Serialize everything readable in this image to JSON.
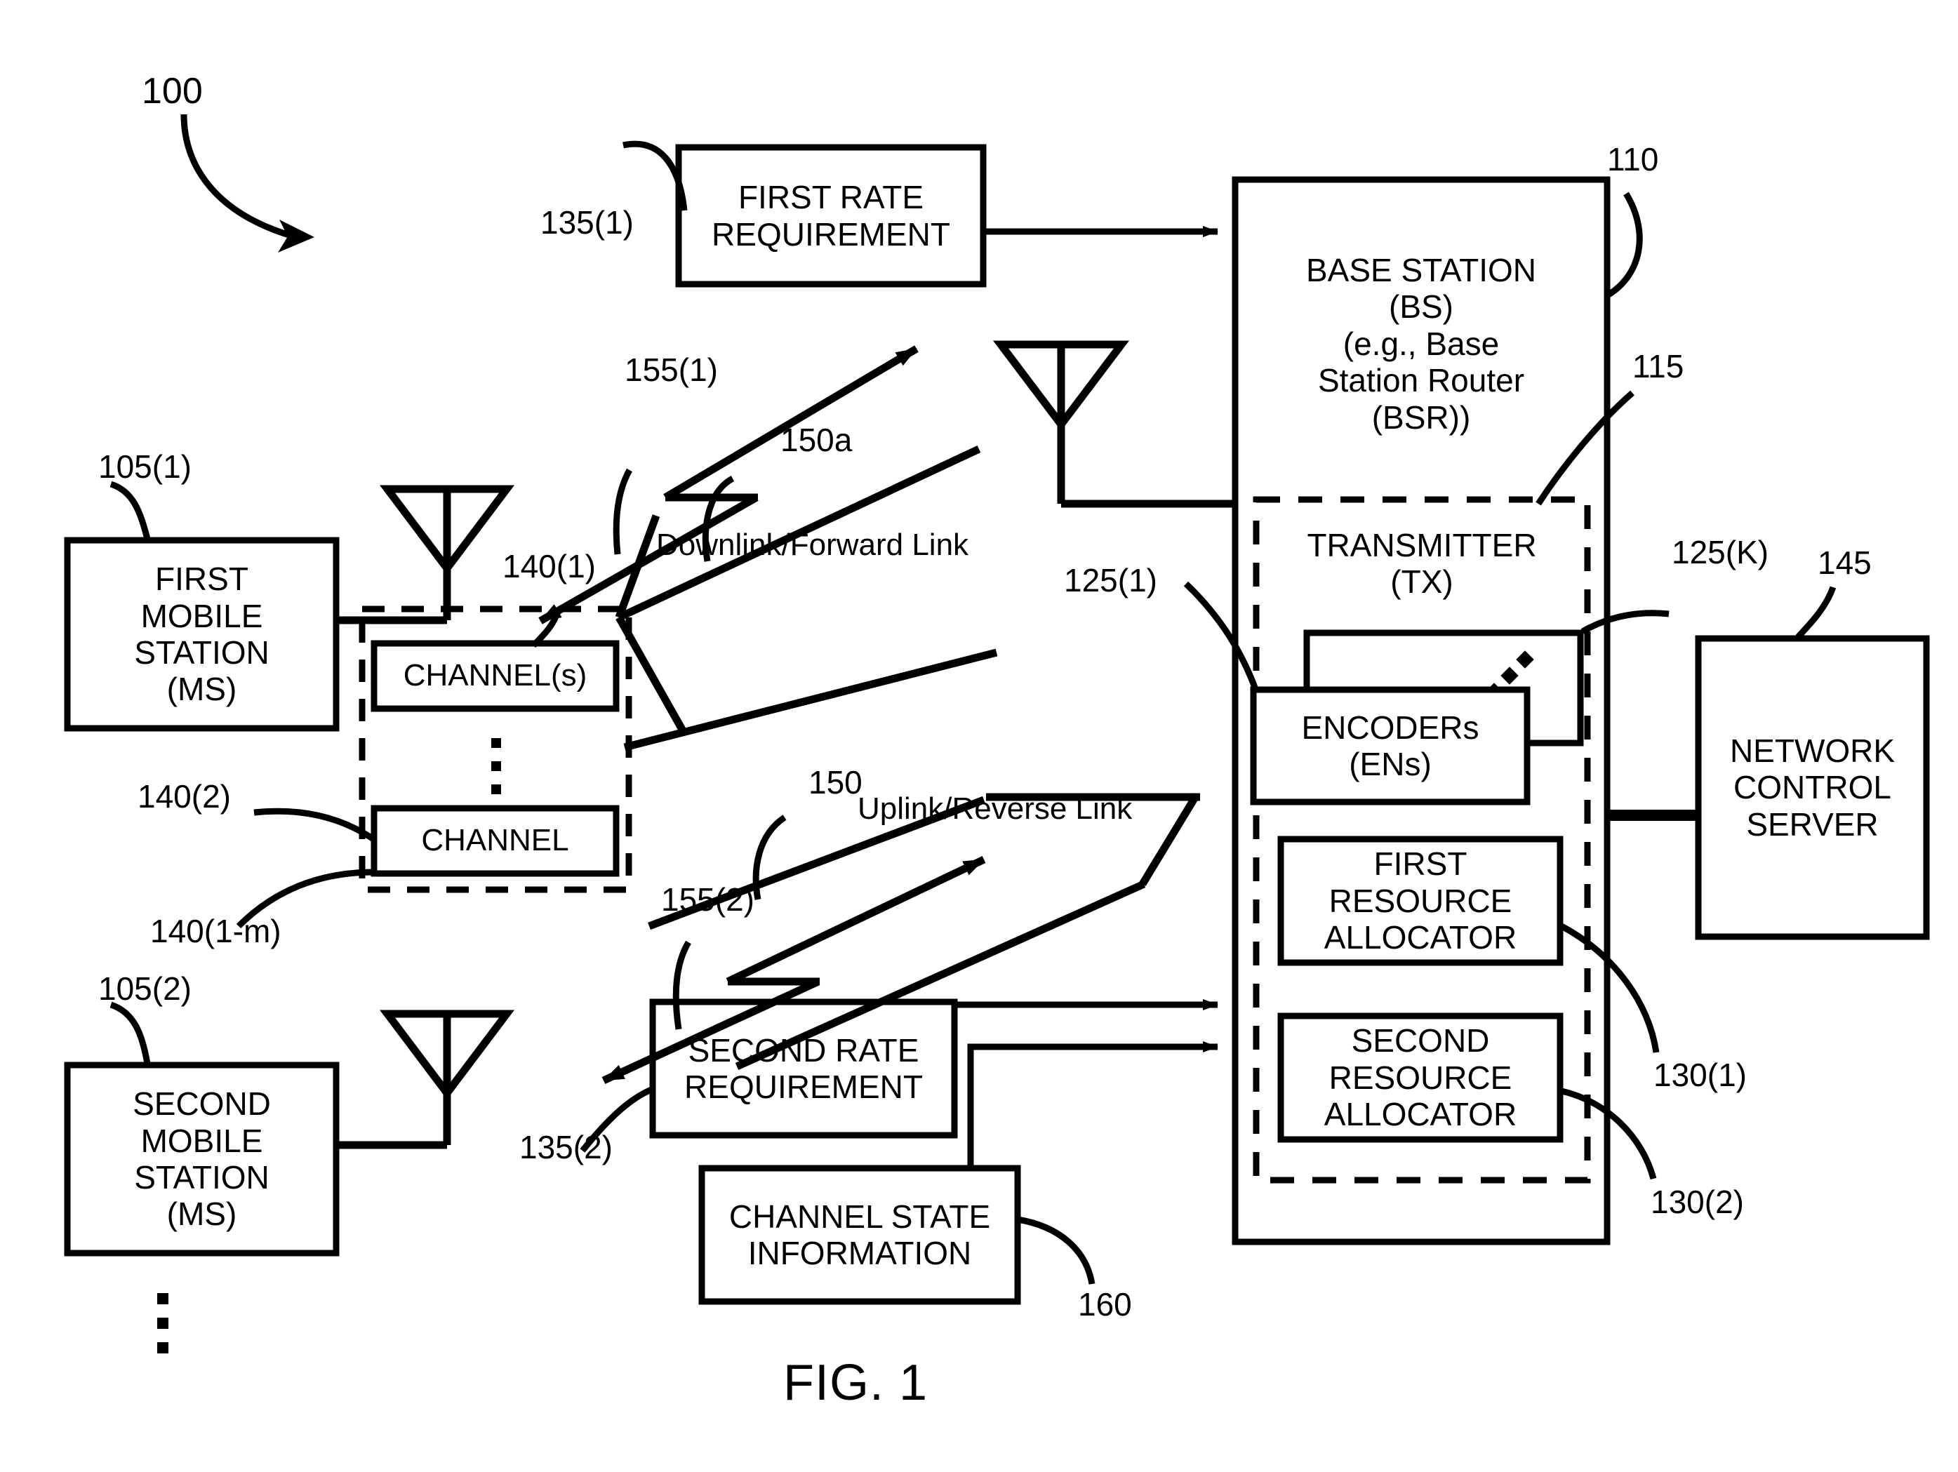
{
  "figure": {
    "caption": "FIG. 1",
    "system_ref": "100"
  },
  "boxes": {
    "first_rate_requirement": {
      "label": "FIRST RATE\nREQUIREMENT",
      "ref": "135(1)"
    },
    "second_rate_requirement": {
      "label": "SECOND RATE\nREQUIREMENT",
      "ref": "135(2)"
    },
    "channel_state_information": {
      "label": "CHANNEL STATE\nINFORMATION",
      "ref": "160"
    },
    "base_station": {
      "label": "BASE STATION\n(BS)\n(e.g., Base\nStation Router\n(BSR))",
      "ref": "110"
    },
    "transmitter": {
      "label": "TRANSMITTER\n(TX)",
      "ref": "115"
    },
    "encoders": {
      "label": "ENCODERs\n(ENs)",
      "ref_first": "125(1)",
      "ref_last": "125(K)"
    },
    "first_resource_allocator": {
      "label": "FIRST\nRESOURCE\nALLOCATOR",
      "ref": "130(1)"
    },
    "second_resource_allocator": {
      "label": "SECOND\nRESOURCE\nALLOCATOR",
      "ref": "130(2)"
    },
    "network_control_server": {
      "label": "NETWORK\nCONTROL\nSERVER",
      "ref": "145"
    },
    "first_mobile_station": {
      "label": "FIRST\nMOBILE\nSTATION\n(MS)",
      "ref": "105(1)"
    },
    "second_mobile_station": {
      "label": "SECOND\nMOBILE\nSTATION\n(MS)",
      "ref": "105(2)"
    },
    "channel_s": {
      "label": "CHANNEL(s)",
      "ref": "140(1)"
    },
    "channel": {
      "label": "CHANNEL",
      "ref": "140(2)"
    },
    "channel_group": {
      "ref": "140(1-m)"
    }
  },
  "links": {
    "downlink": {
      "label": "Downlink/Forward Link",
      "ref": "150a"
    },
    "uplink": {
      "label": "Uplink/Reverse Link",
      "ref": "150"
    },
    "wireless_first": {
      "ref": "155(1)"
    },
    "wireless_second": {
      "ref": "155(2)"
    }
  },
  "colors": {
    "stroke": "#000000",
    "background": "#ffffff"
  }
}
